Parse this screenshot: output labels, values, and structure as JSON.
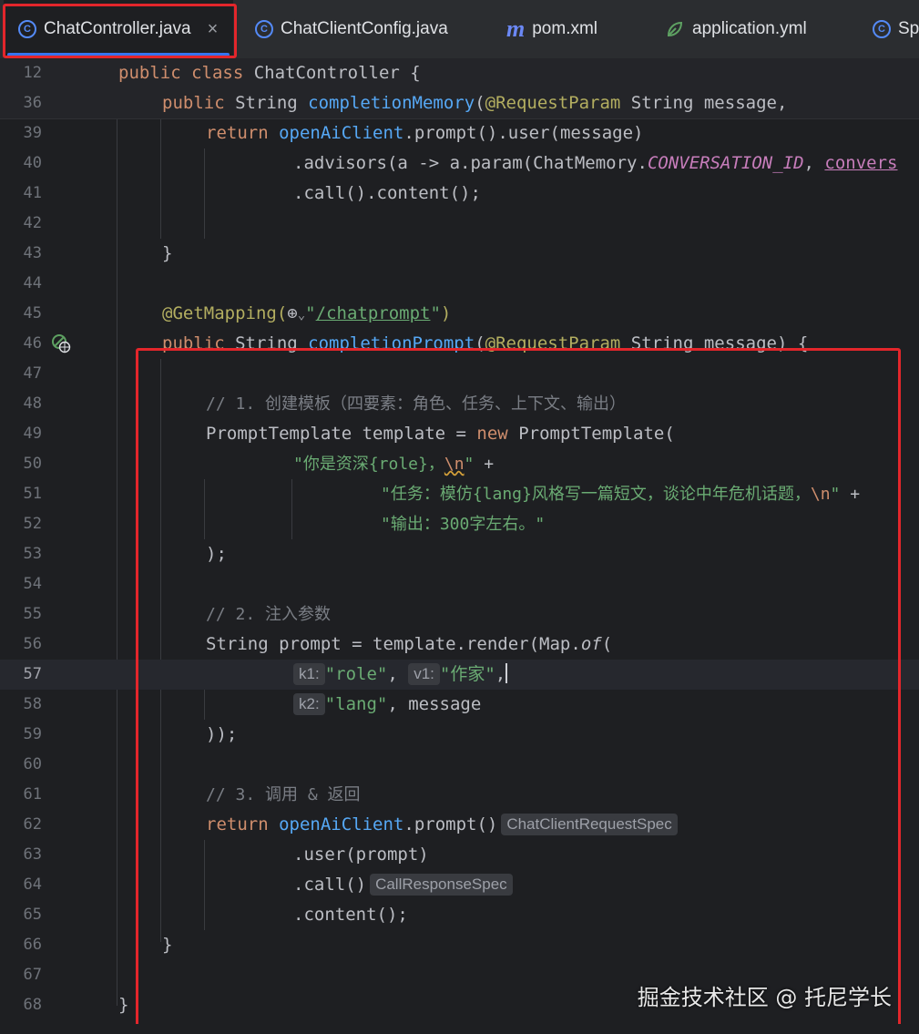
{
  "tabs": [
    {
      "label": "ChatController.java",
      "icon": "class-icon",
      "active": true
    },
    {
      "label": "ChatClientConfig.java",
      "icon": "class-icon",
      "active": false
    },
    {
      "label": "pom.xml",
      "icon": "maven-icon",
      "active": false
    },
    {
      "label": "application.yml",
      "icon": "yml-icon",
      "active": false
    },
    {
      "label": "Sp",
      "icon": "spring-icon",
      "active": false
    }
  ],
  "tab_close_glyph": "×",
  "sticky": [
    {
      "num": "12",
      "code": "public class ChatController {"
    },
    {
      "num": "36",
      "code": "public String completionMemory(@RequestParam String message,"
    }
  ],
  "lines": [
    {
      "num": "39"
    },
    {
      "num": "40"
    },
    {
      "num": "41"
    },
    {
      "num": "42"
    },
    {
      "num": "43"
    },
    {
      "num": "44"
    },
    {
      "num": "45"
    },
    {
      "num": "46"
    },
    {
      "num": "47"
    },
    {
      "num": "48"
    },
    {
      "num": "49"
    },
    {
      "num": "50"
    },
    {
      "num": "51"
    },
    {
      "num": "52"
    },
    {
      "num": "53"
    },
    {
      "num": "54"
    },
    {
      "num": "55"
    },
    {
      "num": "56"
    },
    {
      "num": "57"
    },
    {
      "num": "58"
    },
    {
      "num": "59"
    },
    {
      "num": "60"
    },
    {
      "num": "61"
    },
    {
      "num": "62"
    },
    {
      "num": "63"
    },
    {
      "num": "64"
    },
    {
      "num": "65"
    },
    {
      "num": "66"
    },
    {
      "num": "67"
    },
    {
      "num": "68"
    }
  ],
  "code": {
    "l39_return": "return",
    "l39_client": "openAiClient",
    "l39_rest": ".prompt().user(message)",
    "l40_a": ".advisors(a -> a.param(ChatMemory.",
    "l40_const": "CONVERSATION_ID",
    "l40_comma": ", ",
    "l40_tail": "convers",
    "l41": ".call().content();",
    "l43": "}",
    "l45_ann": "@GetMapping(",
    "l45_globe": "⊕",
    "l45_chev": "⌄",
    "l45_q1": "\"",
    "l45_path": "/chatprompt",
    "l45_q2": "\"",
    "l45_close": ")",
    "l46_kw": "public",
    "l46_type": " String ",
    "l46_fn": "completionPrompt",
    "l46_open": "(",
    "l46_ann": "@RequestParam",
    "l46_rest": " String message) {",
    "l48": "// 1. 创建模板（四要素：角色、任务、上下文、输出）",
    "l49_type": "PromptTemplate template = ",
    "l49_new": "new",
    "l49_rest": " PromptTemplate(",
    "l50_str": "\"你是资深{role}，",
    "l50_esc": "\\n",
    "l50_end": "\"",
    "l50_plus": " +",
    "l51_str": "\"任务：模仿{lang}风格写一篇短文，谈论中年危机话题，",
    "l51_esc": "\\n",
    "l51_end": "\"",
    "l51_plus": " +",
    "l52_str": "\"输出：300字左右。\"",
    "l53": ");",
    "l55": "// 2. 注入参数",
    "l56_a": "String prompt = template.render(Map.",
    "l56_of": "of",
    "l56_b": "(",
    "l57_k1": "k1:",
    "l57_role": "\"role\"",
    "l57_comma1": ", ",
    "l57_v1": "v1:",
    "l57_val": "\"作家\"",
    "l57_comma2": ",",
    "l58_k2": "k2:",
    "l58_lang": "\"lang\"",
    "l58_rest": ", message",
    "l59": "));",
    "l61": "// 3. 调用 & 返回",
    "l62_return": "return",
    "l62_client": "openAiClient",
    "l62_rest": ".prompt()",
    "l62_hint": "ChatClientRequestSpec",
    "l63": ".user(prompt)",
    "l64": ".call()",
    "l64_hint": "CallResponseSpec",
    "l65": ".content();",
    "l66": "}",
    "l68": "}"
  },
  "watermark": "掘金技术社区 @ 托尼学长",
  "colors": {
    "keyword": "#cf8e6d",
    "function": "#56a8f5",
    "annotation": "#b3ae60",
    "string": "#6aab73",
    "comment": "#7a7e85",
    "constant": "#c77dbb",
    "highlight_border": "#e3262b",
    "tab_underline": "#3574f0"
  }
}
